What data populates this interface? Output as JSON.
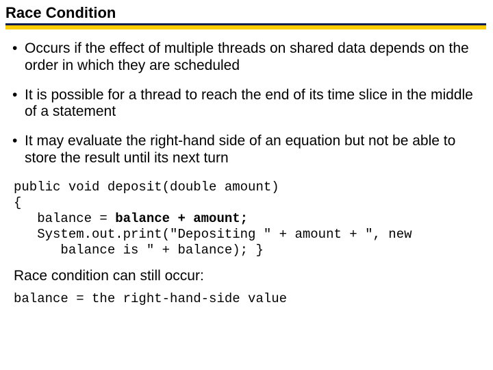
{
  "title": "Race Condition",
  "bullets": [
    "Occurs if the effect of multiple threads on shared data depends on the order in which they are scheduled",
    "It is possible for a thread to reach the end of its time slice in the middle of a statement",
    "It may evaluate the right-hand side of an equation but not be able to store the result until its next turn"
  ],
  "code": {
    "l1": "public void deposit(double amount)",
    "l2": "{",
    "l3a": "   balance = ",
    "l3b": "balance + amount;",
    "l4": "   System.out.print(\"Depositing \" + amount + \", new",
    "l5": "      balance is \" + balance); }"
  },
  "subline": "Race condition can still occur:",
  "code2": "balance = the right-hand-side value"
}
